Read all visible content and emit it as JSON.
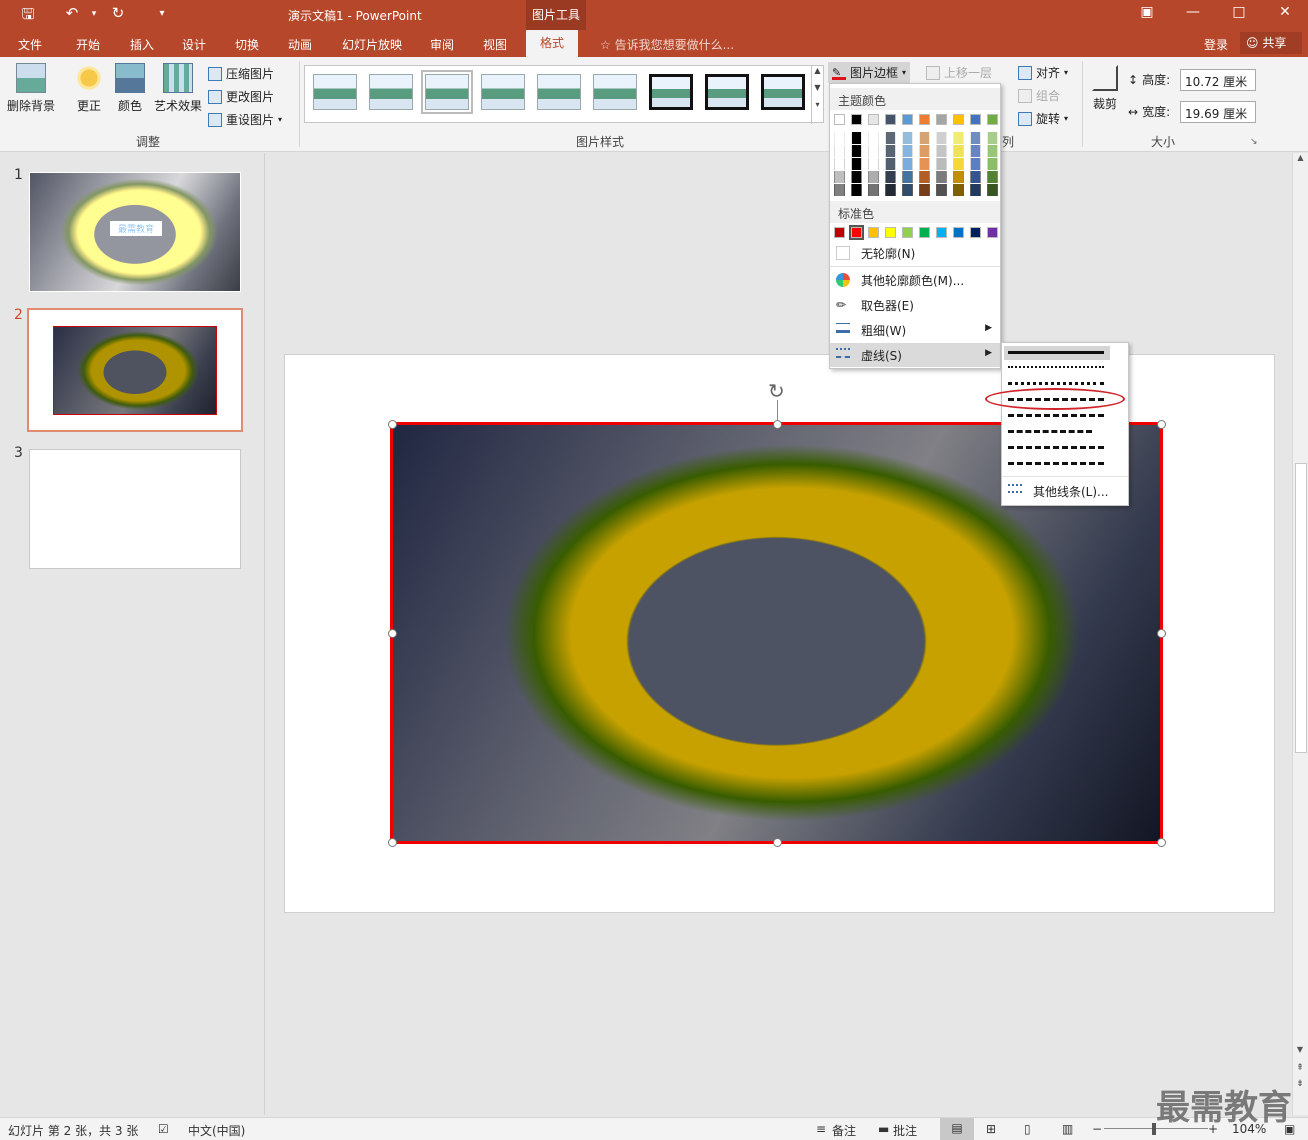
{
  "titlebar": {
    "doc_title": "演示文稿1 - PowerPoint",
    "context_tab": "图片工具",
    "save_icon": "save-icon",
    "undo_icon": "undo-icon",
    "redo_icon": "redo-icon"
  },
  "tabs": [
    "文件",
    "开始",
    "插入",
    "设计",
    "切换",
    "动画",
    "幻灯片放映",
    "审阅",
    "视图"
  ],
  "active_tab": "格式",
  "tellme": "告诉我您想要做什么...",
  "account": {
    "login": "登录",
    "share": "共享"
  },
  "ribbon": {
    "remove_bg": "删除背景",
    "correct": "更正",
    "color": "颜色",
    "art_effect": "艺术效果",
    "compress": "压缩图片",
    "change": "更改图片",
    "reset": "重设图片",
    "group_adjust": "调整",
    "group_styles": "图片样式",
    "border_btn": "图片边框",
    "bring_forward": "上移一层",
    "align": "对齐",
    "group": "组合",
    "rotate": "旋转",
    "group_arrange_tail": "列",
    "crop": "裁剪",
    "height_label": "高度:",
    "height_value": "10.72 厘米",
    "width_label": "宽度:",
    "width_value": "19.69 厘米",
    "group_size": "大小"
  },
  "slides": [
    "1",
    "2",
    "3"
  ],
  "thumb1_text": "最需教育",
  "border_menu": {
    "theme_colors": "主题颜色",
    "standard_colors": "标准色",
    "no_outline": "无轮廓(N)",
    "more_colors": "其他轮廓颜色(M)...",
    "eyedropper": "取色器(E)",
    "weight": "粗细(W)",
    "dashes": "虚线(S)",
    "theme_top": [
      "#ffffff",
      "#000000",
      "#e7e6e6",
      "#44546a",
      "#5b9bd5",
      "#ed7d31",
      "#a5a5a5",
      "#ffc000",
      "#4472c4",
      "#70ad47"
    ],
    "standard": [
      "#c00000",
      "#ff0000",
      "#ffc000",
      "#ffff00",
      "#92d050",
      "#00b050",
      "#00b0f0",
      "#0070c0",
      "#002060",
      "#7030a0"
    ]
  },
  "dash_menu": {
    "more_lines": "其他线条(L)..."
  },
  "status": {
    "slide_info": "幻灯片 第 2 张，共 3 张",
    "lang": "中文(中国)",
    "notes": "备注",
    "comments": "批注",
    "zoom": "104%"
  },
  "watermark": "最需教育"
}
